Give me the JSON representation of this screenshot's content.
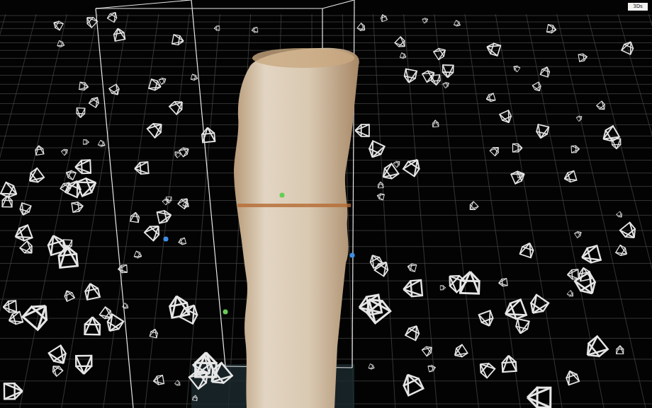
{
  "viewport": {
    "badge": "3Ds"
  },
  "markers": [
    {
      "color": "#3d8fe6"
    },
    {
      "color": "#3d8fe6"
    },
    {
      "color": "#66cc55"
    },
    {
      "color": "#66cc55"
    }
  ]
}
